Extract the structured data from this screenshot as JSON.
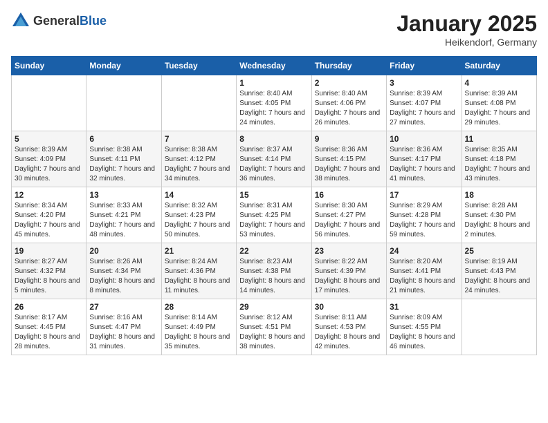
{
  "logo": {
    "general": "General",
    "blue": "Blue"
  },
  "title": "January 2025",
  "subtitle": "Heikendorf, Germany",
  "days_of_week": [
    "Sunday",
    "Monday",
    "Tuesday",
    "Wednesday",
    "Thursday",
    "Friday",
    "Saturday"
  ],
  "weeks": [
    [
      {
        "day": "",
        "content": ""
      },
      {
        "day": "",
        "content": ""
      },
      {
        "day": "",
        "content": ""
      },
      {
        "day": "1",
        "content": "Sunrise: 8:40 AM\nSunset: 4:05 PM\nDaylight: 7 hours and 24 minutes."
      },
      {
        "day": "2",
        "content": "Sunrise: 8:40 AM\nSunset: 4:06 PM\nDaylight: 7 hours and 26 minutes."
      },
      {
        "day": "3",
        "content": "Sunrise: 8:39 AM\nSunset: 4:07 PM\nDaylight: 7 hours and 27 minutes."
      },
      {
        "day": "4",
        "content": "Sunrise: 8:39 AM\nSunset: 4:08 PM\nDaylight: 7 hours and 29 minutes."
      }
    ],
    [
      {
        "day": "5",
        "content": "Sunrise: 8:39 AM\nSunset: 4:09 PM\nDaylight: 7 hours and 30 minutes."
      },
      {
        "day": "6",
        "content": "Sunrise: 8:38 AM\nSunset: 4:11 PM\nDaylight: 7 hours and 32 minutes."
      },
      {
        "day": "7",
        "content": "Sunrise: 8:38 AM\nSunset: 4:12 PM\nDaylight: 7 hours and 34 minutes."
      },
      {
        "day": "8",
        "content": "Sunrise: 8:37 AM\nSunset: 4:14 PM\nDaylight: 7 hours and 36 minutes."
      },
      {
        "day": "9",
        "content": "Sunrise: 8:36 AM\nSunset: 4:15 PM\nDaylight: 7 hours and 38 minutes."
      },
      {
        "day": "10",
        "content": "Sunrise: 8:36 AM\nSunset: 4:17 PM\nDaylight: 7 hours and 41 minutes."
      },
      {
        "day": "11",
        "content": "Sunrise: 8:35 AM\nSunset: 4:18 PM\nDaylight: 7 hours and 43 minutes."
      }
    ],
    [
      {
        "day": "12",
        "content": "Sunrise: 8:34 AM\nSunset: 4:20 PM\nDaylight: 7 hours and 45 minutes."
      },
      {
        "day": "13",
        "content": "Sunrise: 8:33 AM\nSunset: 4:21 PM\nDaylight: 7 hours and 48 minutes."
      },
      {
        "day": "14",
        "content": "Sunrise: 8:32 AM\nSunset: 4:23 PM\nDaylight: 7 hours and 50 minutes."
      },
      {
        "day": "15",
        "content": "Sunrise: 8:31 AM\nSunset: 4:25 PM\nDaylight: 7 hours and 53 minutes."
      },
      {
        "day": "16",
        "content": "Sunrise: 8:30 AM\nSunset: 4:27 PM\nDaylight: 7 hours and 56 minutes."
      },
      {
        "day": "17",
        "content": "Sunrise: 8:29 AM\nSunset: 4:28 PM\nDaylight: 7 hours and 59 minutes."
      },
      {
        "day": "18",
        "content": "Sunrise: 8:28 AM\nSunset: 4:30 PM\nDaylight: 8 hours and 2 minutes."
      }
    ],
    [
      {
        "day": "19",
        "content": "Sunrise: 8:27 AM\nSunset: 4:32 PM\nDaylight: 8 hours and 5 minutes."
      },
      {
        "day": "20",
        "content": "Sunrise: 8:26 AM\nSunset: 4:34 PM\nDaylight: 8 hours and 8 minutes."
      },
      {
        "day": "21",
        "content": "Sunrise: 8:24 AM\nSunset: 4:36 PM\nDaylight: 8 hours and 11 minutes."
      },
      {
        "day": "22",
        "content": "Sunrise: 8:23 AM\nSunset: 4:38 PM\nDaylight: 8 hours and 14 minutes."
      },
      {
        "day": "23",
        "content": "Sunrise: 8:22 AM\nSunset: 4:39 PM\nDaylight: 8 hours and 17 minutes."
      },
      {
        "day": "24",
        "content": "Sunrise: 8:20 AM\nSunset: 4:41 PM\nDaylight: 8 hours and 21 minutes."
      },
      {
        "day": "25",
        "content": "Sunrise: 8:19 AM\nSunset: 4:43 PM\nDaylight: 8 hours and 24 minutes."
      }
    ],
    [
      {
        "day": "26",
        "content": "Sunrise: 8:17 AM\nSunset: 4:45 PM\nDaylight: 8 hours and 28 minutes."
      },
      {
        "day": "27",
        "content": "Sunrise: 8:16 AM\nSunset: 4:47 PM\nDaylight: 8 hours and 31 minutes."
      },
      {
        "day": "28",
        "content": "Sunrise: 8:14 AM\nSunset: 4:49 PM\nDaylight: 8 hours and 35 minutes."
      },
      {
        "day": "29",
        "content": "Sunrise: 8:12 AM\nSunset: 4:51 PM\nDaylight: 8 hours and 38 minutes."
      },
      {
        "day": "30",
        "content": "Sunrise: 8:11 AM\nSunset: 4:53 PM\nDaylight: 8 hours and 42 minutes."
      },
      {
        "day": "31",
        "content": "Sunrise: 8:09 AM\nSunset: 4:55 PM\nDaylight: 8 hours and 46 minutes."
      },
      {
        "day": "",
        "content": ""
      }
    ]
  ]
}
